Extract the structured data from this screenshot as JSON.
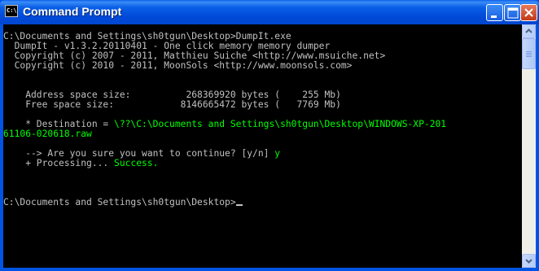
{
  "window": {
    "title": "Command Prompt",
    "icon": "console-icon",
    "icon_glyph": "C:\\"
  },
  "controls": {
    "minimize": "minimize-icon",
    "maximize": "maximize-icon",
    "close": "close-icon"
  },
  "console": {
    "lines": [
      "C:\\Documents and Settings\\sh0tgun\\Desktop>DumpIt.exe",
      "  DumpIt - v1.3.2.20110401 - One click memory memory dumper",
      "  Copyright (c) 2007 - 2011, Matthieu Suiche <http://www.msuiche.net>",
      "  Copyright (c) 2010 - 2011, MoonSols <http://www.moonsols.com>",
      "",
      "",
      "    Address space size:          268369920 bytes (    255 Mb)",
      "    Free space size:            8146665472 bytes (   7769 Mb)",
      "",
      "    * Destination = ",
      "",
      "",
      "    --> Are you sure you want to continue? [y/n] ",
      "    + Processing... ",
      "",
      "",
      "",
      "C:\\Documents and Settings\\sh0tgun\\Desktop>"
    ],
    "destination_path_line1": "\\??\\C:\\Documents and Settings\\sh0tgun\\Desktop\\WINDOWS-XP-201",
    "destination_path_line2": "61106-020618.raw",
    "answer": "y",
    "status": "Success.",
    "highlight_color": "#00ff00",
    "text_color": "#c0c0c0",
    "background_color": "#000000"
  }
}
